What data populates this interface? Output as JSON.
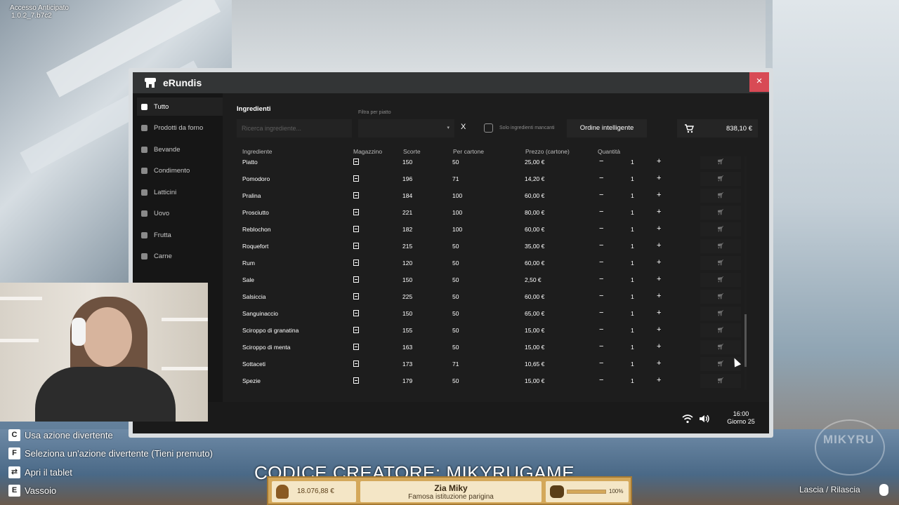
{
  "version": {
    "line1": "Accesso Anticipato",
    "line2": "1.0.2_7.b7c2"
  },
  "app": {
    "title": "eRundis",
    "close": "×"
  },
  "sidebar": {
    "items": [
      {
        "label": "Tutto",
        "active": true
      },
      {
        "label": "Prodotti da forno"
      },
      {
        "label": "Bevande"
      },
      {
        "label": "Condimento"
      },
      {
        "label": "Latticini"
      },
      {
        "label": "Uovo"
      },
      {
        "label": "Frutta"
      },
      {
        "label": "Carne"
      }
    ]
  },
  "toolbar": {
    "section_title": "Ingredienti",
    "search_placeholder": "Ricerca ingrediente...",
    "filter_label": "Filtra per piatto",
    "clear": "X",
    "missing_only_label": "Solo ingredienti mancanti",
    "smart_order_label": "Ordine intelligente",
    "cart_total": "838,10 €"
  },
  "table": {
    "headers": {
      "name": "Ingrediente",
      "store": "Magazzino",
      "stock": "Scorte",
      "carton": "Per cartone",
      "price": "Prezzo (cartone)",
      "qty": "Quantità"
    },
    "rows": [
      {
        "name": "Piatto",
        "stock": "150",
        "carton": "50",
        "price": "25,00 €",
        "qty": "1"
      },
      {
        "name": "Pomodoro",
        "stock": "196",
        "carton": "71",
        "price": "14,20 €",
        "qty": "1"
      },
      {
        "name": "Pralina",
        "stock": "184",
        "carton": "100",
        "price": "60,00 €",
        "qty": "1"
      },
      {
        "name": "Prosciutto",
        "stock": "221",
        "carton": "100",
        "price": "80,00 €",
        "qty": "1"
      },
      {
        "name": "Reblochon",
        "stock": "182",
        "carton": "100",
        "price": "60,00 €",
        "qty": "1"
      },
      {
        "name": "Roquefort",
        "stock": "215",
        "carton": "50",
        "price": "35,00 €",
        "qty": "1"
      },
      {
        "name": "Rum",
        "stock": "120",
        "carton": "50",
        "price": "60,00 €",
        "qty": "1"
      },
      {
        "name": "Sale",
        "stock": "150",
        "carton": "50",
        "price": "2,50 €",
        "qty": "1"
      },
      {
        "name": "Salsiccia",
        "stock": "225",
        "carton": "50",
        "price": "60,00 €",
        "qty": "1"
      },
      {
        "name": "Sanguinaccio",
        "stock": "150",
        "carton": "50",
        "price": "65,00 €",
        "qty": "1"
      },
      {
        "name": "Sciroppo di granatina",
        "stock": "155",
        "carton": "50",
        "price": "15,00 €",
        "qty": "1"
      },
      {
        "name": "Sciroppo di menta",
        "stock": "163",
        "carton": "50",
        "price": "15,00 €",
        "qty": "1"
      },
      {
        "name": "Sottaceti",
        "stock": "173",
        "carton": "71",
        "price": "10,65 €",
        "qty": "1"
      },
      {
        "name": "Spezie",
        "stock": "179",
        "carton": "50",
        "price": "15,00 €",
        "qty": "1"
      }
    ],
    "minus": "−",
    "plus": "+",
    "add_cart_icon": "cart-plus-icon"
  },
  "status": {
    "time": "16:00",
    "day": "Giorno 25"
  },
  "hints": [
    {
      "key": "C",
      "label": "Usa azione divertente"
    },
    {
      "key": "F",
      "label": "Seleziona un'azione divertente (Tieni premuto)"
    },
    {
      "key": "⇄",
      "label": "Apri il tablet"
    },
    {
      "key": "E",
      "label": "Vassoio"
    }
  ],
  "overlay": {
    "creator_code": "CODICE CREATORE: MIKYRUGAME",
    "watermark": "MIKYRU"
  },
  "hud": {
    "money": "18.076,88 €",
    "name": "Zia Miky",
    "subtitle": "Famosa istituzione parigina",
    "reputation": 1.0,
    "reputation_label": "100%"
  },
  "release_hint": "Lascia / Rilascia",
  "colors": {
    "close": "#d84a55",
    "hud": "#d4a85a",
    "panel": "#1d1d1d"
  }
}
